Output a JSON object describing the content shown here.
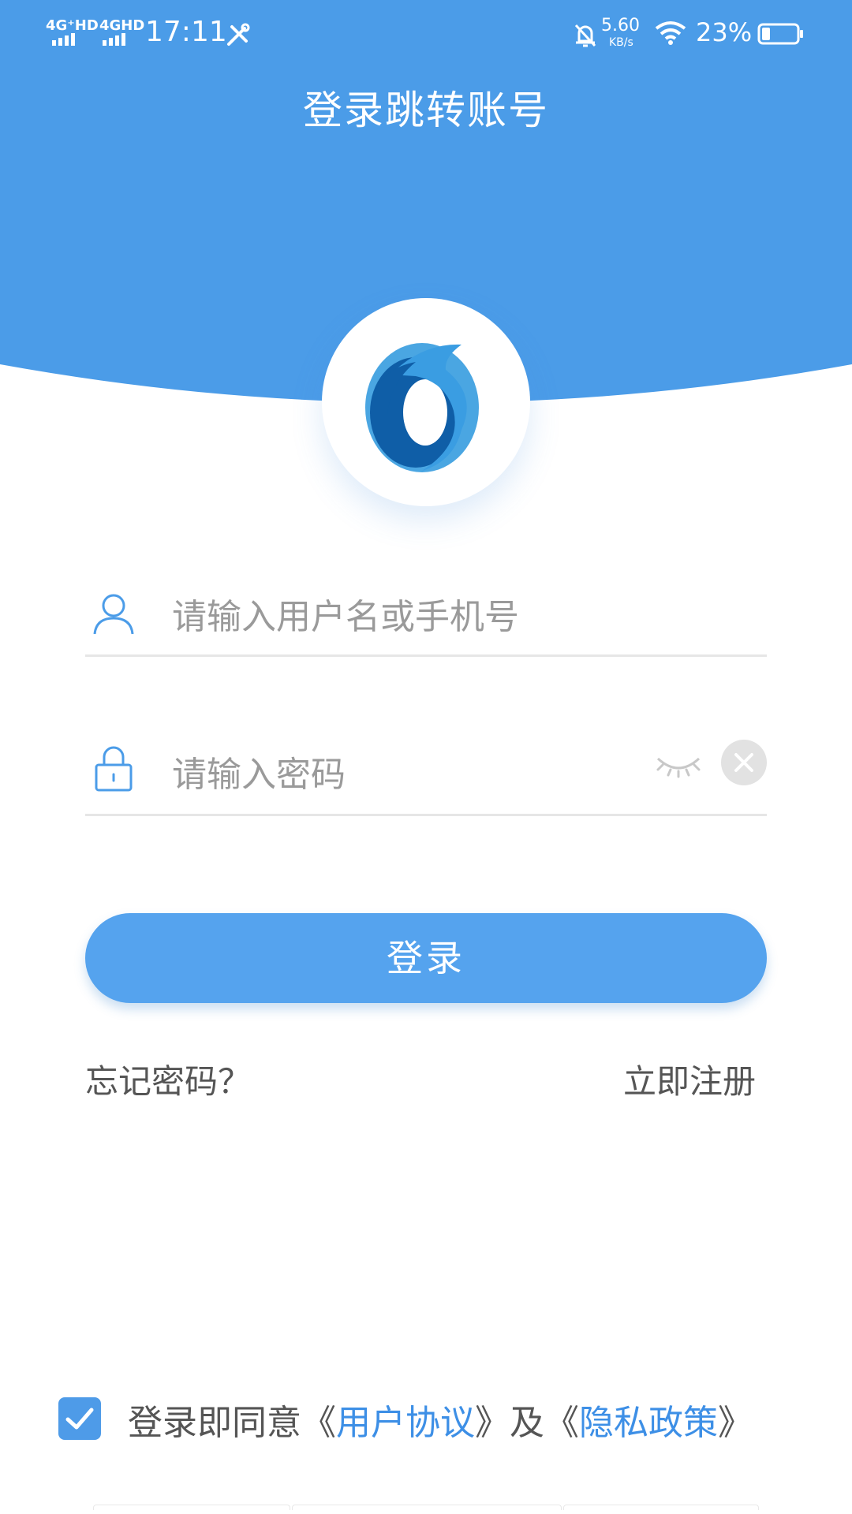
{
  "status_bar": {
    "network1": "4G⁺HD",
    "network2": "4GHD",
    "time": "17:11",
    "speed_value": "5.60",
    "speed_unit": "KB/s",
    "battery": "23%"
  },
  "header": {
    "title": "登录跳转账号"
  },
  "login": {
    "username_placeholder": "请输入用户名或手机号",
    "password_placeholder": "请输入密码",
    "submit_label": "登录",
    "forgot_label": "忘记密码？",
    "register_label": "立即注册"
  },
  "agreement": {
    "prefix": "登录即同意《",
    "user_agreement": "用户协议",
    "middle": "》及《",
    "privacy_policy": "隐私政策",
    "suffix": "》",
    "checked": true
  },
  "colors": {
    "brand": "#4b9ce8",
    "button": "#55a3ee",
    "link": "#3d8fe6"
  },
  "icons": [
    "bell-off-icon",
    "wifi-icon",
    "battery-icon",
    "tools-icon",
    "user-icon",
    "lock-icon",
    "eye-closed-icon",
    "clear-icon",
    "check-icon",
    "app-logo"
  ]
}
